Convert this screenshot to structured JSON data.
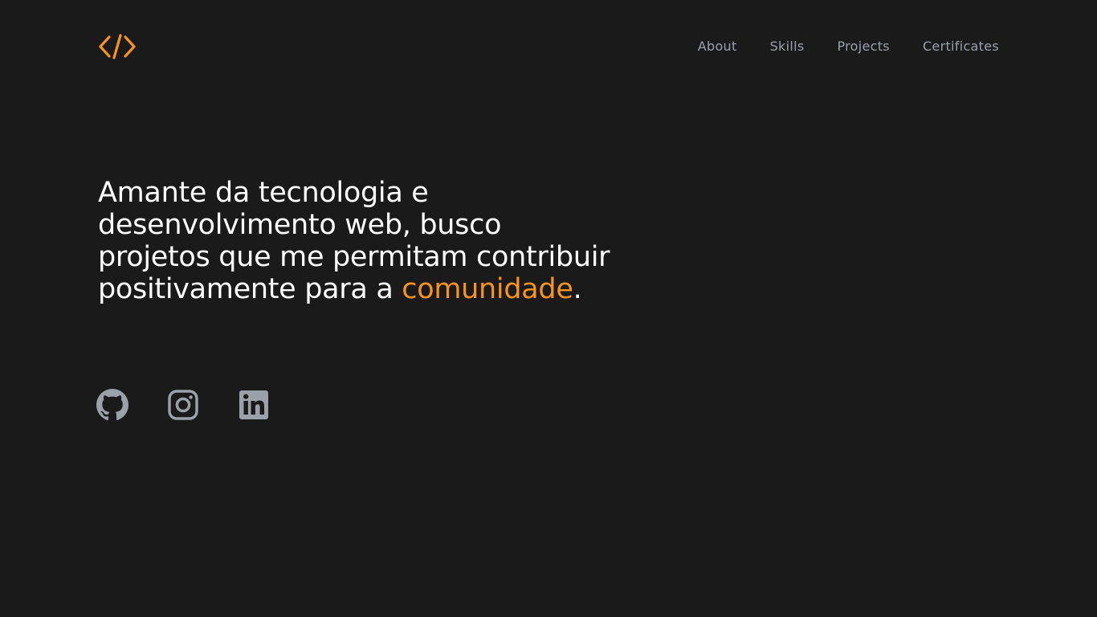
{
  "logo": {
    "icon": "code-brackets-icon",
    "color": "#f7931e"
  },
  "nav": {
    "items": [
      {
        "label": "About"
      },
      {
        "label": "Skills"
      },
      {
        "label": "Projects"
      },
      {
        "label": "Certificates"
      }
    ]
  },
  "hero": {
    "text": "Amante da tecnologia e desenvolvimento web, busco projetos que me permitam contribuir positivamente para a",
    "highlight": "comunidade",
    "end": ".",
    "accent_color": "#f7931e"
  },
  "socials": {
    "items": [
      {
        "icon": "github-icon"
      },
      {
        "icon": "instagram-icon"
      },
      {
        "icon": "linkedin-icon"
      }
    ],
    "color": "#9ca0a8"
  },
  "colors": {
    "background": "#1a1a1a",
    "text": "#ffffff",
    "nav_text": "#9ca0a8"
  }
}
